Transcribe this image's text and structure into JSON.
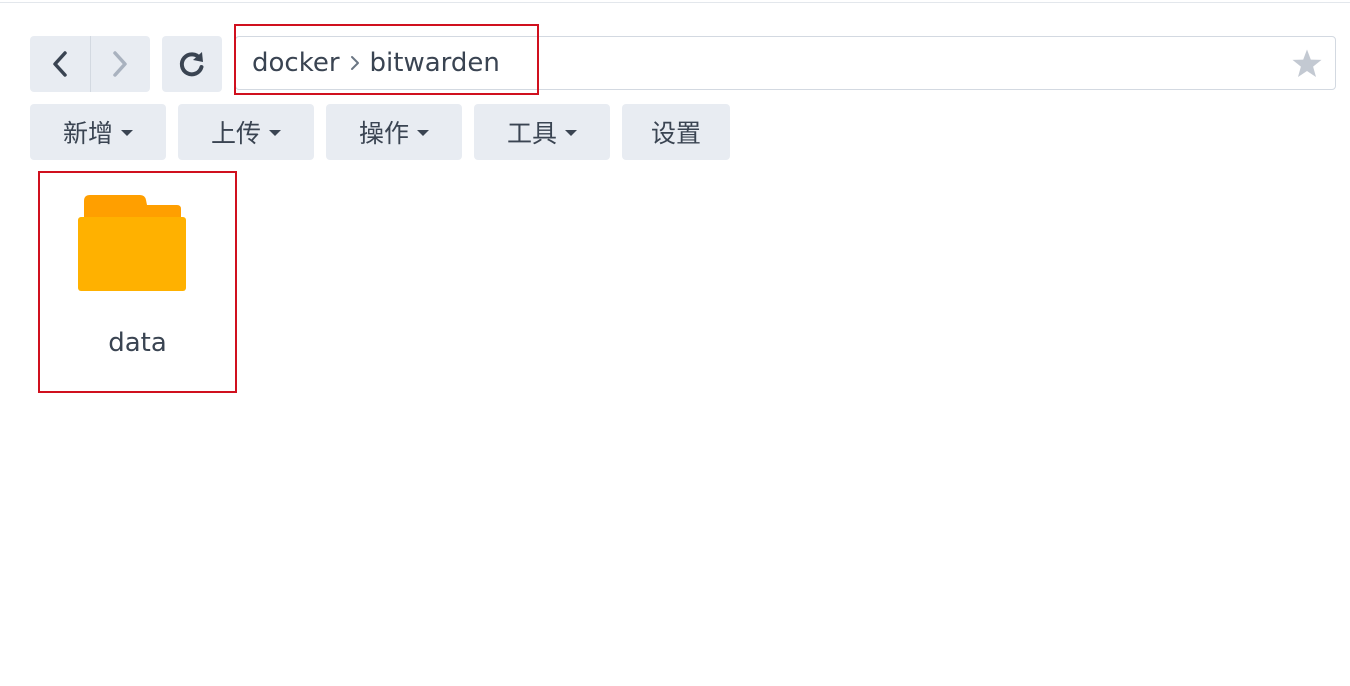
{
  "navigation": {
    "back_icon": "chevron-left-icon",
    "forward_icon": "chevron-right-icon",
    "refresh_icon": "refresh-icon"
  },
  "path": {
    "crumbs": [
      "docker",
      "bitwarden"
    ],
    "separator_icon": "chevron-right-icon",
    "favorite_icon": "star-icon"
  },
  "toolbar": {
    "new_label": "新增",
    "upload_label": "上传",
    "action_label": "操作",
    "tools_label": "工具",
    "settings_label": "设置"
  },
  "files": [
    {
      "name": "data",
      "type": "folder"
    }
  ],
  "colors": {
    "button_bg": "#e8ecf2",
    "text": "#3a4452",
    "highlight": "#d0101e",
    "folder_front": "#ffb100",
    "folder_back": "#ff9f00"
  }
}
